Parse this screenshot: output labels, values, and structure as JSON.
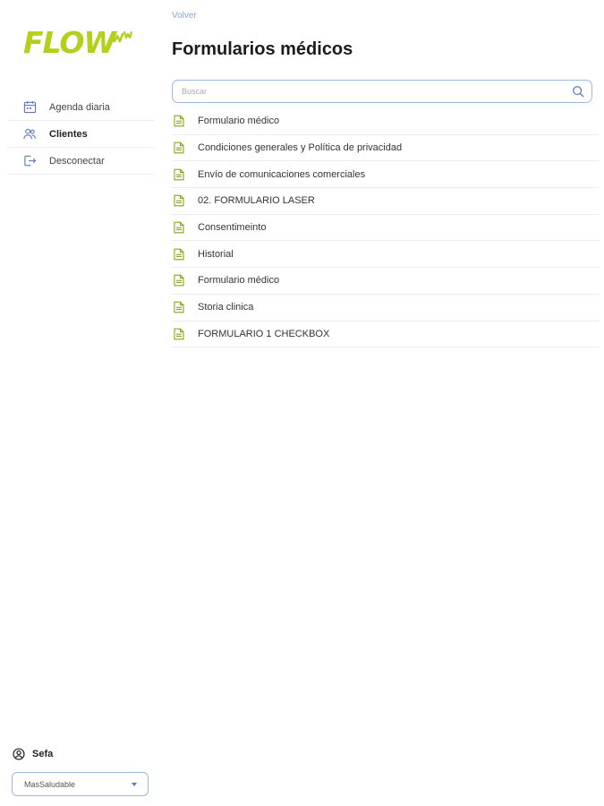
{
  "brand": {
    "logo_text": "FLOW",
    "accent": "#b5cf1b"
  },
  "sidebar": {
    "items": [
      {
        "label": "Agenda diaria",
        "icon": "calendar-icon",
        "active": false
      },
      {
        "label": "Clientes",
        "icon": "users-icon",
        "active": true
      },
      {
        "label": "Desconectar",
        "icon": "logout-icon",
        "active": false
      }
    ],
    "user": {
      "name": "Sefa",
      "icon": "user-circle-icon"
    },
    "center_select": {
      "value": "MasSaludable"
    }
  },
  "main": {
    "back_label": "Volver",
    "title": "Formularios médicos",
    "search": {
      "placeholder": "Buscar",
      "value": ""
    },
    "forms": [
      "Formulario médico",
      "Condiciones generales y Política de privacidad",
      "Envío de comunicaciones comerciales",
      "02. FORMULARIO LASER",
      "Consentimeinto",
      "Historial",
      "Formulario médico",
      "Storia clinica",
      "FORMULARIO 1 CHECKBOX"
    ]
  },
  "colors": {
    "link": "#8ba4d6",
    "border_accent": "#9fb6e0",
    "icon_green": "#8ca11a",
    "icon_blue": "#5a7bb8"
  }
}
